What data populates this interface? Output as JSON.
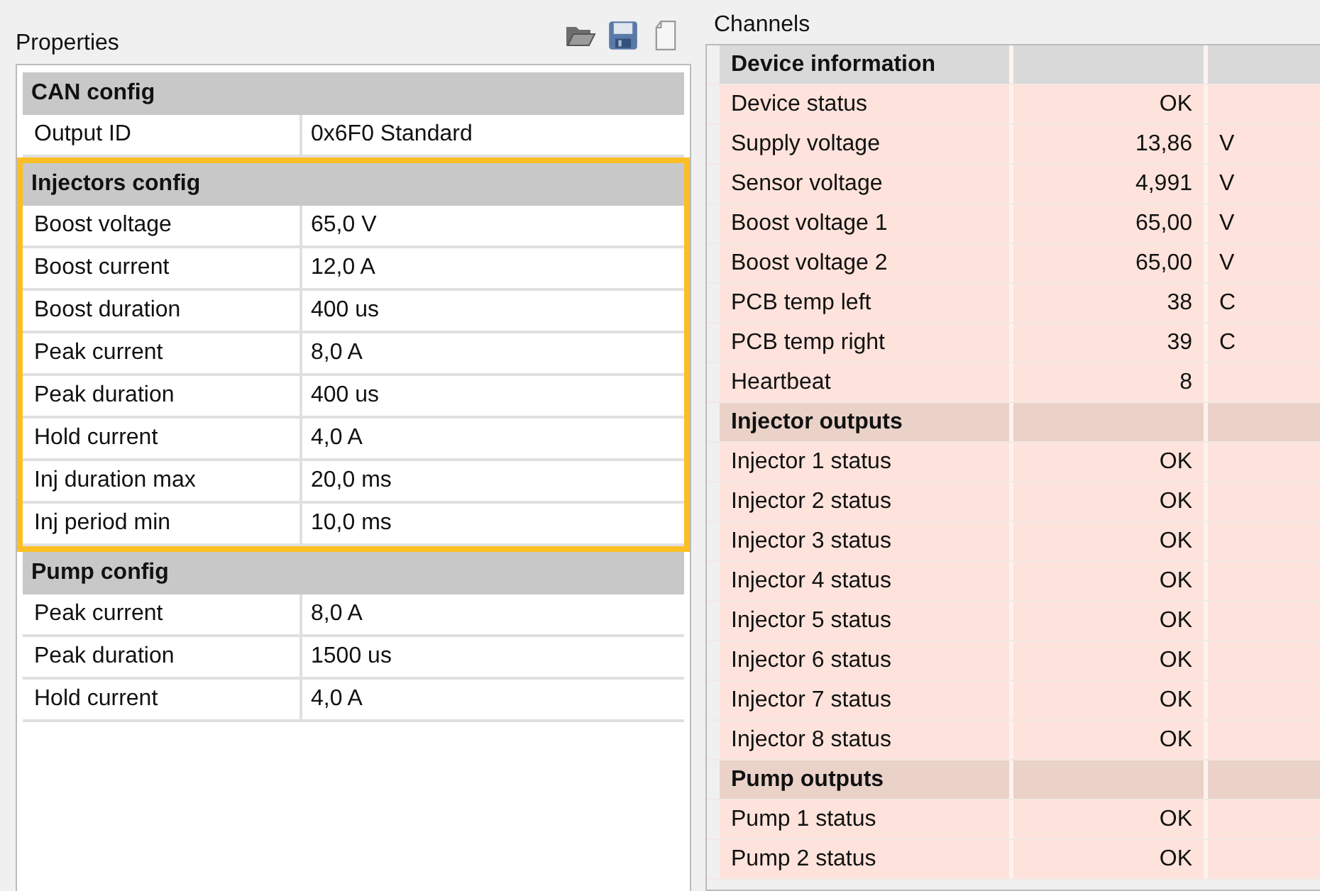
{
  "properties": {
    "title": "Properties",
    "groups": [
      {
        "name": "CAN config",
        "highlighted": false,
        "rows": [
          {
            "label": "Output ID",
            "value": "0x6F0   Standard"
          }
        ]
      },
      {
        "name": "Injectors config",
        "highlighted": true,
        "rows": [
          {
            "label": "Boost voltage",
            "value": "65,0 V"
          },
          {
            "label": "Boost current",
            "value": "12,0 A"
          },
          {
            "label": "Boost duration",
            "value": "400 us"
          },
          {
            "label": "Peak current",
            "value": "8,0 A"
          },
          {
            "label": "Peak duration",
            "value": "400 us"
          },
          {
            "label": "Hold current",
            "value": "4,0 A"
          },
          {
            "label": "Inj duration max",
            "value": "20,0 ms"
          },
          {
            "label": "Inj period min",
            "value": "10,0 ms"
          }
        ]
      },
      {
        "name": "Pump config",
        "highlighted": false,
        "rows": [
          {
            "label": "Peak current",
            "value": "8,0 A"
          },
          {
            "label": "Peak duration",
            "value": "1500 us"
          },
          {
            "label": "Hold current",
            "value": "4,0 A"
          }
        ]
      }
    ]
  },
  "channels": {
    "title": "Channels",
    "groups": [
      {
        "name": "Device information",
        "color": "#d9d9d9",
        "rows": [
          {
            "label": "Device status",
            "value": "OK"
          },
          {
            "label": "Supply voltage",
            "value": "13,86",
            "unit": "V"
          },
          {
            "label": "Sensor voltage",
            "value": "4,991",
            "unit": "V"
          },
          {
            "label": "Boost voltage 1",
            "value": "65,00",
            "unit": "V"
          },
          {
            "label": "Boost voltage 2",
            "value": "65,00",
            "unit": "V"
          },
          {
            "label": "PCB temp left",
            "value": "38",
            "unit": "C"
          },
          {
            "label": "PCB temp right",
            "value": "39",
            "unit": "C"
          },
          {
            "label": "Heartbeat",
            "value": "8"
          }
        ]
      },
      {
        "name": "Injector outputs",
        "color": "#ead2c9",
        "rows": [
          {
            "label": "Injector 1 status",
            "value": "OK"
          },
          {
            "label": "Injector 2 status",
            "value": "OK"
          },
          {
            "label": "Injector 3 status",
            "value": "OK"
          },
          {
            "label": "Injector 4 status",
            "value": "OK"
          },
          {
            "label": "Injector 5 status",
            "value": "OK"
          },
          {
            "label": "Injector 6 status",
            "value": "OK"
          },
          {
            "label": "Injector 7 status",
            "value": "OK"
          },
          {
            "label": "Injector 8 status",
            "value": "OK"
          }
        ]
      },
      {
        "name": "Pump outputs",
        "color": "#ead2c9",
        "rows": [
          {
            "label": "Pump 1 status",
            "value": "OK"
          },
          {
            "label": "Pump 2 status",
            "value": "OK"
          }
        ]
      }
    ]
  }
}
